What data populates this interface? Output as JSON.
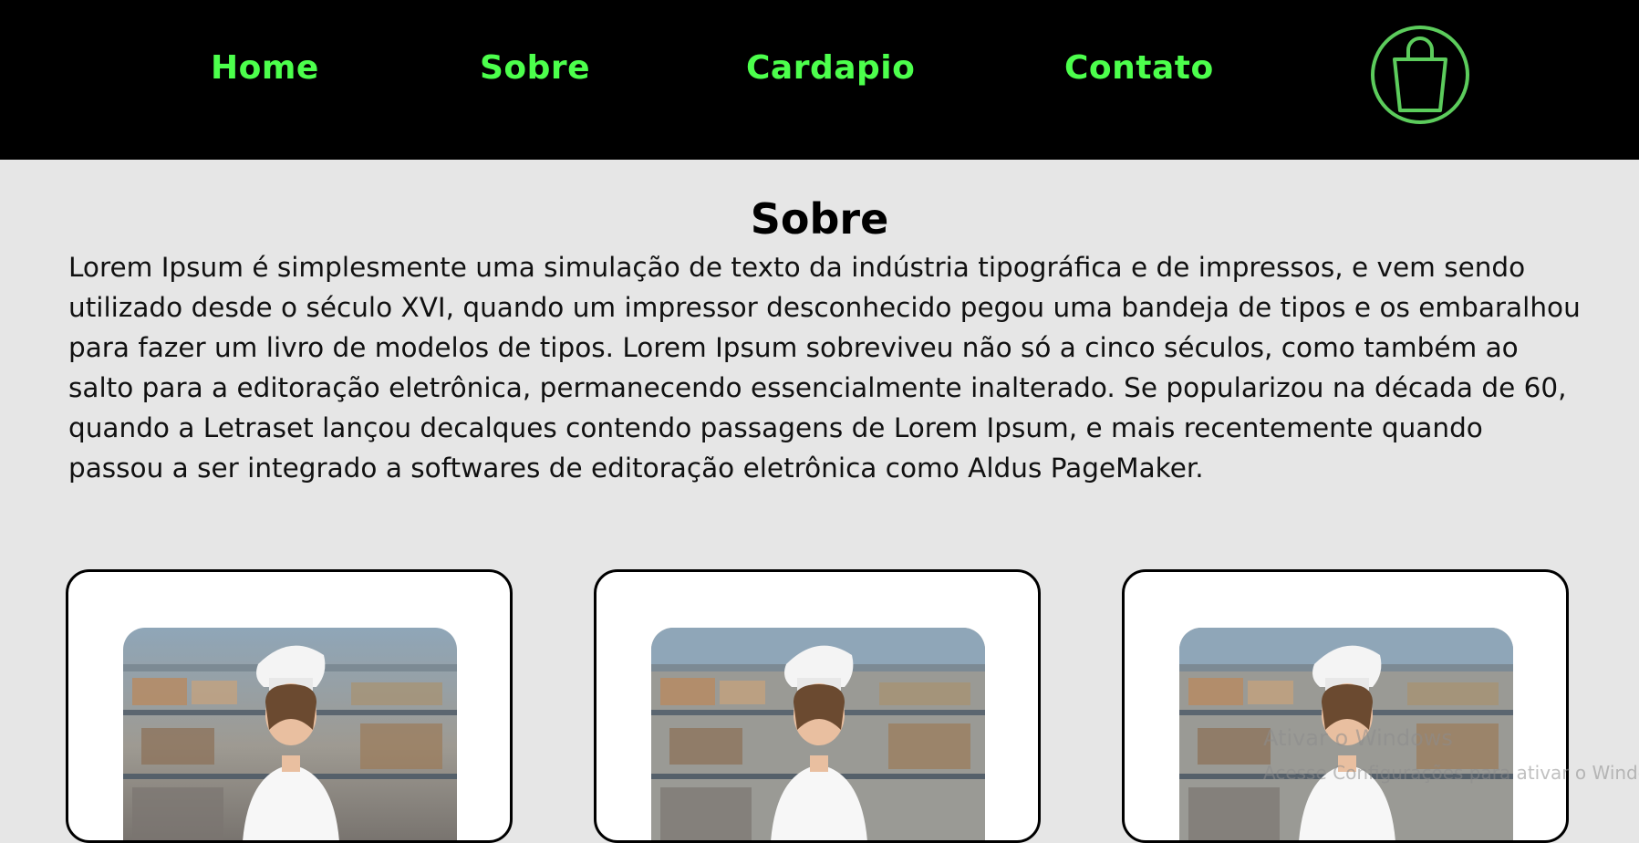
{
  "nav": {
    "items": [
      {
        "label": "Home"
      },
      {
        "label": "Sobre"
      },
      {
        "label": "Cardapio"
      },
      {
        "label": "Contato"
      }
    ],
    "cart_icon": "shopping-bag-icon",
    "accent_color": "#4cff4c",
    "cart_color": "#5ccc5c"
  },
  "about": {
    "title": "Sobre",
    "text": "Lorem Ipsum é simplesmente uma simulação de texto da indústria tipográfica e de impressos, e vem sendo utilizado desde o século XVI, quando um impressor desconhecido pegou uma bandeja de tipos e os embaralhou para fazer um livro de modelos de tipos. Lorem Ipsum sobreviveu não só a cinco séculos, como também ao salto para a editoração eletrônica, permanecendo essencialmente inalterado. Se popularizou na década de 60, quando a Letraset lançou decalques contendo passagens de Lorem Ipsum, e mais recentemente quando passou a ser integrado a softwares de editoração eletrônica como Aldus PageMaker."
  },
  "cards": [
    {
      "image": "chef-photo"
    },
    {
      "image": "chef-photo"
    },
    {
      "image": "chef-photo"
    }
  ],
  "watermark": {
    "line1": "Ativar o Windows",
    "line2": "Acesse Configurações para ativar o Windows."
  }
}
